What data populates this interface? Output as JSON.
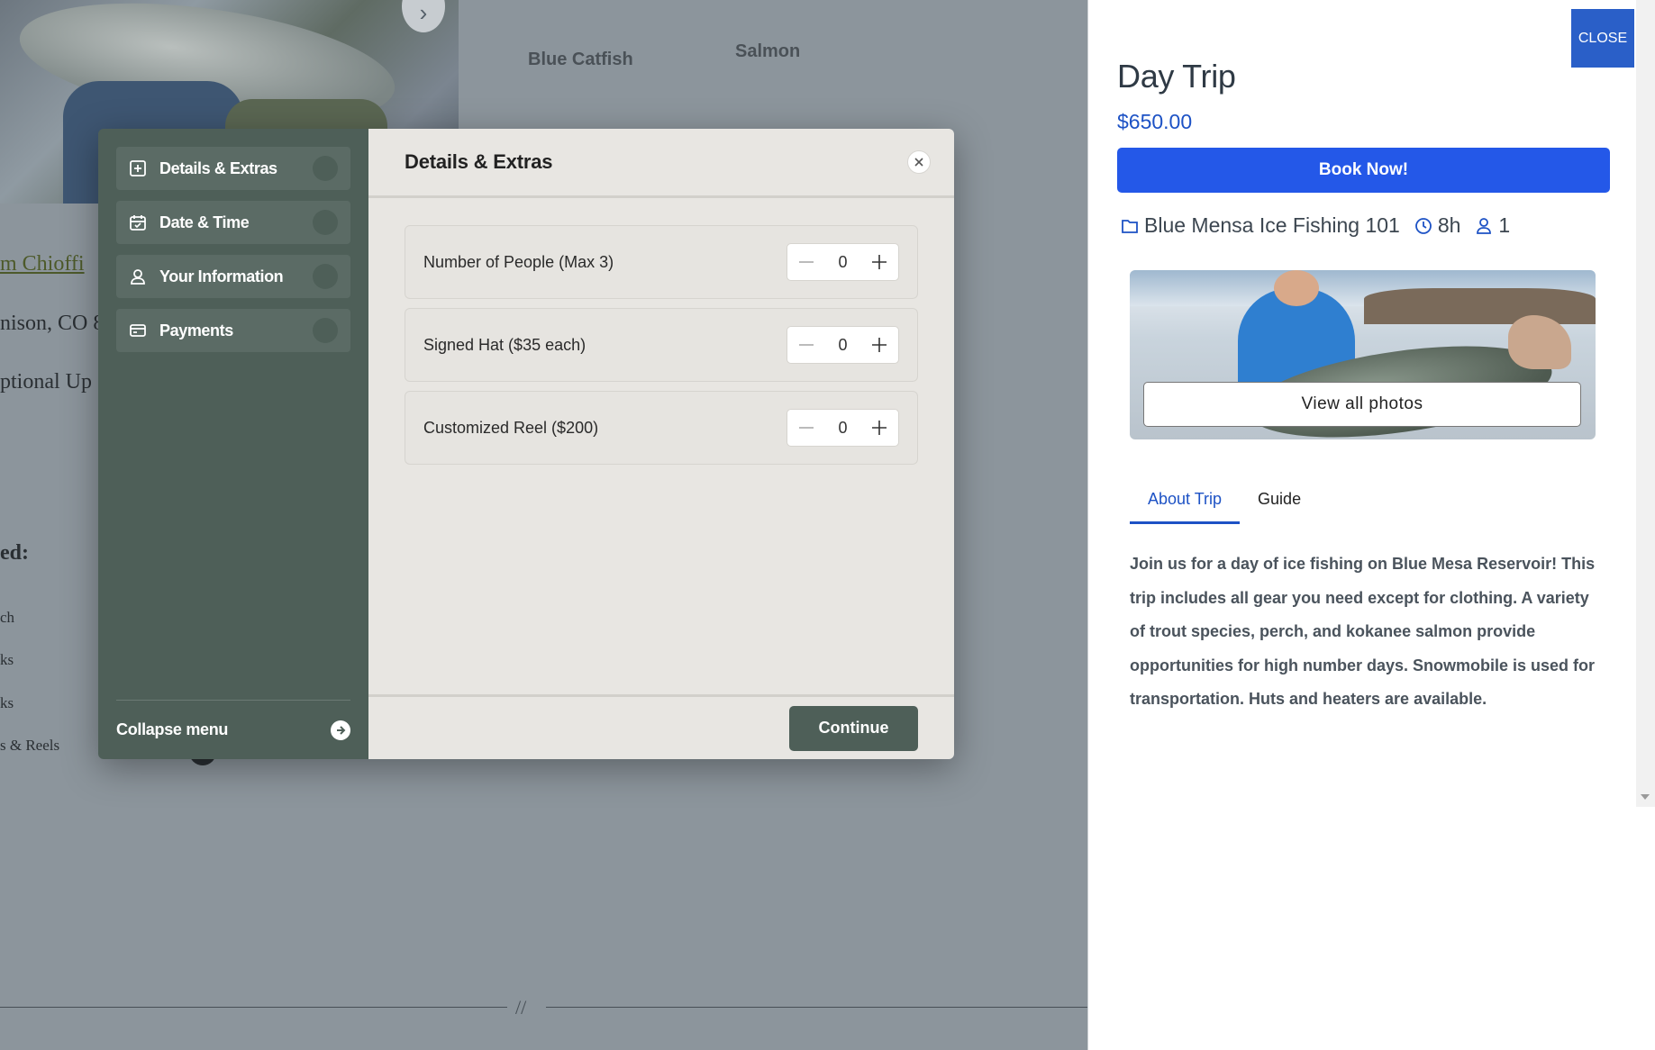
{
  "background": {
    "fish_tabs": [
      "Blue Catfish",
      "Salmon"
    ],
    "guide_link": "m Chioffi",
    "location_text": "nison, CO 8",
    "upgrades_text": "ptional Up",
    "included_heading": "ed:",
    "included_items": [
      "ch",
      "ks",
      "ks",
      "s & Reels"
    ],
    "divider_text": "//"
  },
  "modal": {
    "steps": [
      {
        "label": "Details & Extras",
        "icon": "plus-square-icon"
      },
      {
        "label": "Date & Time",
        "icon": "calendar-icon"
      },
      {
        "label": "Your Information",
        "icon": "user-icon"
      },
      {
        "label": "Payments",
        "icon": "credit-card-icon"
      }
    ],
    "collapse_label": "Collapse menu",
    "title": "Details & Extras",
    "extras": [
      {
        "label": "Number of People (Max 3)",
        "qty": "0"
      },
      {
        "label": "Signed Hat ($35 each)",
        "qty": "0"
      },
      {
        "label": "Customized Reel ($200)",
        "qty": "0"
      }
    ],
    "continue_label": "Continue"
  },
  "panel": {
    "close_label": "CLOSE",
    "title": "Day Trip",
    "price": "$650.00",
    "book_label": "Book Now!",
    "meta": {
      "course": "Blue Mensa Ice Fishing 101",
      "duration": "8h",
      "people": "1"
    },
    "view_photos_label": "View all photos",
    "tabs": [
      "About Trip",
      "Guide"
    ],
    "active_tab": "About Trip",
    "about_text": "Join us for a day of ice fishing on Blue Mesa Reservoir! This trip includes all gear you need except for clothing. A variety of trout species, perch, and kokanee salmon provide opportunities for high number days. Snowmobile is used for transportation. Huts and heaters are available."
  },
  "colors": {
    "sidebar": "#4e5f58",
    "primary_blue": "#2458e8",
    "price_blue": "#1d52c5",
    "close_blue": "#2a5fc8",
    "overlay": "#8c959c"
  }
}
